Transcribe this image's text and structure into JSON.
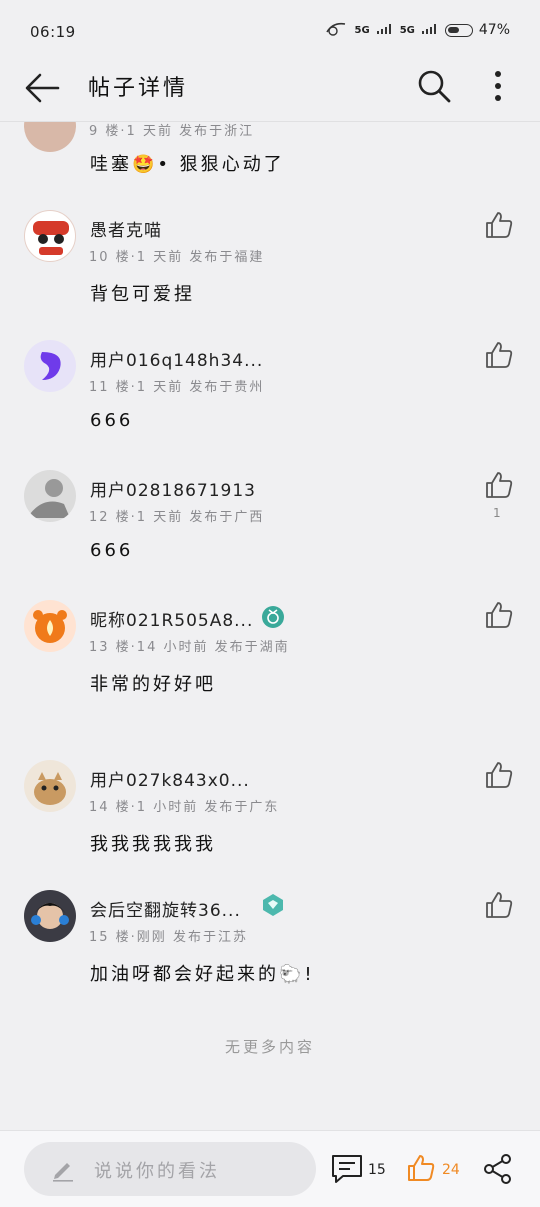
{
  "status_bar": {
    "time": "06:19",
    "network1": "5G",
    "network2": "5G",
    "battery": "47%"
  },
  "header": {
    "title": "帖子详情"
  },
  "comments": [
    {
      "floor_meta": "9 楼·1 天前   发布于浙江",
      "text": "哇塞🤩• 狠狠心动了"
    },
    {
      "username": "愚者克喵",
      "floor_meta": "10 楼·1 天前   发布于福建",
      "text": "背包可爱捏",
      "likes": ""
    },
    {
      "username": "用户016q148h34...",
      "floor_meta": "11 楼·1 天前   发布于贵州",
      "text": "666",
      "likes": ""
    },
    {
      "username": "用户02818671913",
      "floor_meta": "12 楼·1 天前   发布于广西",
      "text": "666",
      "likes": "1"
    },
    {
      "username": "昵称021R505A8...",
      "floor_meta": "13 楼·14 小时前   发布于湖南",
      "text": "非常的好好吧",
      "likes": ""
    },
    {
      "username": "用户027k843x0...",
      "floor_meta": "14 楼·1 小时前   发布于广东",
      "text": "我我我我我我",
      "likes": ""
    },
    {
      "username": "会后空翻旋转36...",
      "floor_meta": "15 楼·刚刚   发布于江苏",
      "text": "加油呀都会好起来的🐑!",
      "likes": ""
    }
  ],
  "no_more": "无更多内容",
  "bottom_bar": {
    "placeholder": "说说你的看法",
    "comment_count": "15",
    "like_count": "24"
  },
  "colors": {
    "accent": "#f08a24",
    "badge_teal": "#3aa99a",
    "text_gray": "#8a8a8e"
  }
}
